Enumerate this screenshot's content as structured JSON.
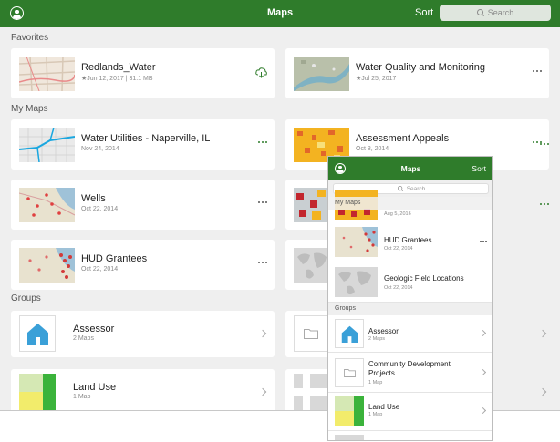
{
  "tablet": {
    "header": {
      "title": "Maps",
      "sort_label": "Sort",
      "search_placeholder": "Search"
    },
    "sections": {
      "favorites": "Favorites",
      "my_maps": "My Maps",
      "groups": "Groups"
    },
    "favorites": [
      {
        "name": "Redlands_Water",
        "meta": "★Jun 12, 2017 | 31.1 MB",
        "action": "download-icon"
      },
      {
        "name": "Water Quality and Monitoring",
        "meta": "★Jul 25, 2017",
        "action": "more-icon"
      }
    ],
    "my_maps": [
      {
        "name": "Water Utilities - Naperville, IL",
        "meta": "Nov 24, 2014"
      },
      {
        "name": "Assessment Appeals",
        "meta": "Oct 8, 2014"
      },
      {
        "name": "Wells",
        "meta": "Oct 22, 2014"
      },
      {
        "name": "HUD Grantees",
        "meta": "Oct 22, 2014"
      }
    ],
    "groups": [
      {
        "name": "Assessor",
        "meta": "2 Maps"
      },
      {
        "name": "Land Use",
        "meta": "1 Map"
      }
    ]
  },
  "phone": {
    "header": {
      "title": "Maps",
      "sort_label": "Sort",
      "search_placeholder": "Search"
    },
    "sections": {
      "my_maps": "My Maps",
      "groups": "Groups"
    },
    "partial_row_meta": "Aug 5, 2016",
    "my_maps": [
      {
        "name": "HUD Grantees",
        "meta": "Oct 22, 2014"
      },
      {
        "name": "Geologic Field Locations",
        "meta": "Oct 22, 2014"
      }
    ],
    "groups": [
      {
        "name": "Assessor",
        "meta": "2 Maps"
      },
      {
        "name": "Community Development Projects",
        "meta": "1 Map"
      },
      {
        "name": "Land Use",
        "meta": "1 Map"
      }
    ]
  },
  "colors": {
    "accent": "#2f7c2b",
    "house": "#3aa0d8",
    "landuse_green": "#3bb33b",
    "landuse_yellow": "#f2ec6b"
  }
}
